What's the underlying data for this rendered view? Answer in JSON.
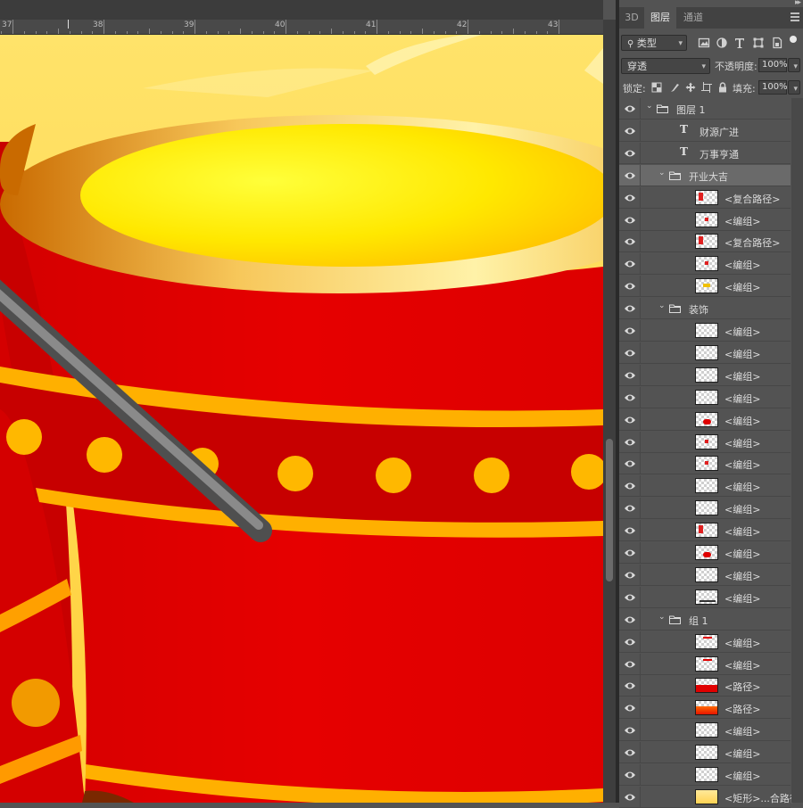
{
  "ruler": {
    "marks": [
      "37",
      "38",
      "39",
      "40",
      "41",
      "42",
      "43"
    ]
  },
  "panel": {
    "tabs": [
      {
        "label": "3D"
      },
      {
        "label": "图层",
        "active": true
      },
      {
        "label": "通道"
      }
    ],
    "filter": {
      "kind_label": "类型"
    },
    "blend": {
      "mode": "穿透",
      "opacity_label": "不透明度:",
      "opacity": "100%"
    },
    "lock": {
      "label": "锁定:",
      "fill_label": "填充:",
      "fill": "100%"
    },
    "layers": [
      {
        "name": "图层 1",
        "kind": "group",
        "indent": 0,
        "expanded": true
      },
      {
        "name": "财源广进",
        "kind": "text",
        "indent": 1
      },
      {
        "name": "万事亨通",
        "kind": "text",
        "indent": 1
      },
      {
        "name": "开业大吉",
        "kind": "group",
        "indent": 1,
        "expanded": true,
        "selected": true
      },
      {
        "name": "<复合路径>",
        "kind": "thumb",
        "indent": 2,
        "thumb": "red-mark"
      },
      {
        "name": "<编组>",
        "kind": "thumb",
        "indent": 2,
        "thumb": "red-mark-small"
      },
      {
        "name": "<复合路径>",
        "kind": "thumb",
        "indent": 2,
        "thumb": "red-mark"
      },
      {
        "name": "<编组>",
        "kind": "thumb",
        "indent": 2,
        "thumb": "red-mark-small"
      },
      {
        "name": "<编组>",
        "kind": "thumb",
        "indent": 2,
        "thumb": "yellow-mark"
      },
      {
        "name": "装饰",
        "kind": "group",
        "indent": 1,
        "expanded": true
      },
      {
        "name": "<编组>",
        "kind": "thumb",
        "indent": 2,
        "thumb": "empty"
      },
      {
        "name": "<编组>",
        "kind": "thumb",
        "indent": 2,
        "thumb": "empty"
      },
      {
        "name": "<编组>",
        "kind": "thumb",
        "indent": 2,
        "thumb": "empty"
      },
      {
        "name": "<编组>",
        "kind": "thumb",
        "indent": 2,
        "thumb": "empty"
      },
      {
        "name": "<编组>",
        "kind": "thumb",
        "indent": 2,
        "thumb": "red-blob"
      },
      {
        "name": "<编组>",
        "kind": "thumb",
        "indent": 2,
        "thumb": "red-mark-small"
      },
      {
        "name": "<编组>",
        "kind": "thumb",
        "indent": 2,
        "thumb": "red-mark-small"
      },
      {
        "name": "<编组>",
        "kind": "thumb",
        "indent": 2,
        "thumb": "empty"
      },
      {
        "name": "<编组>",
        "kind": "thumb",
        "indent": 2,
        "thumb": "empty"
      },
      {
        "name": "<编组>",
        "kind": "thumb",
        "indent": 2,
        "thumb": "red-mark"
      },
      {
        "name": "<编组>",
        "kind": "thumb",
        "indent": 2,
        "thumb": "red-blob"
      },
      {
        "name": "<编组>",
        "kind": "thumb",
        "indent": 2,
        "thumb": "empty"
      },
      {
        "name": "<编组>",
        "kind": "thumb",
        "indent": 2,
        "thumb": "dark-line"
      },
      {
        "name": "组 1",
        "kind": "group",
        "indent": 1,
        "expanded": true
      },
      {
        "name": "<编组>",
        "kind": "thumb",
        "indent": 2,
        "thumb": "red-line-top"
      },
      {
        "name": "<编组>",
        "kind": "thumb",
        "indent": 2,
        "thumb": "red-line-top"
      },
      {
        "name": "<路径>",
        "kind": "thumb",
        "indent": 2,
        "thumb": "red-half"
      },
      {
        "name": "<路径>",
        "kind": "thumb",
        "indent": 2,
        "thumb": "red-orange-half"
      },
      {
        "name": "<编组>",
        "kind": "thumb",
        "indent": 2,
        "thumb": "empty"
      },
      {
        "name": "<编组>",
        "kind": "thumb",
        "indent": 2,
        "thumb": "empty"
      },
      {
        "name": "<编组>",
        "kind": "thumb",
        "indent": 2,
        "thumb": "empty"
      },
      {
        "name": "<矩形>...合路径>",
        "kind": "thumb",
        "indent": 2,
        "thumb": "yellow-fill"
      }
    ]
  },
  "colors": {
    "drum_red": "#e40000",
    "drum_dark_red": "#c80000",
    "gold": "#ffb000",
    "yellow": "#ffe200",
    "stick": "#7a7a7a"
  }
}
